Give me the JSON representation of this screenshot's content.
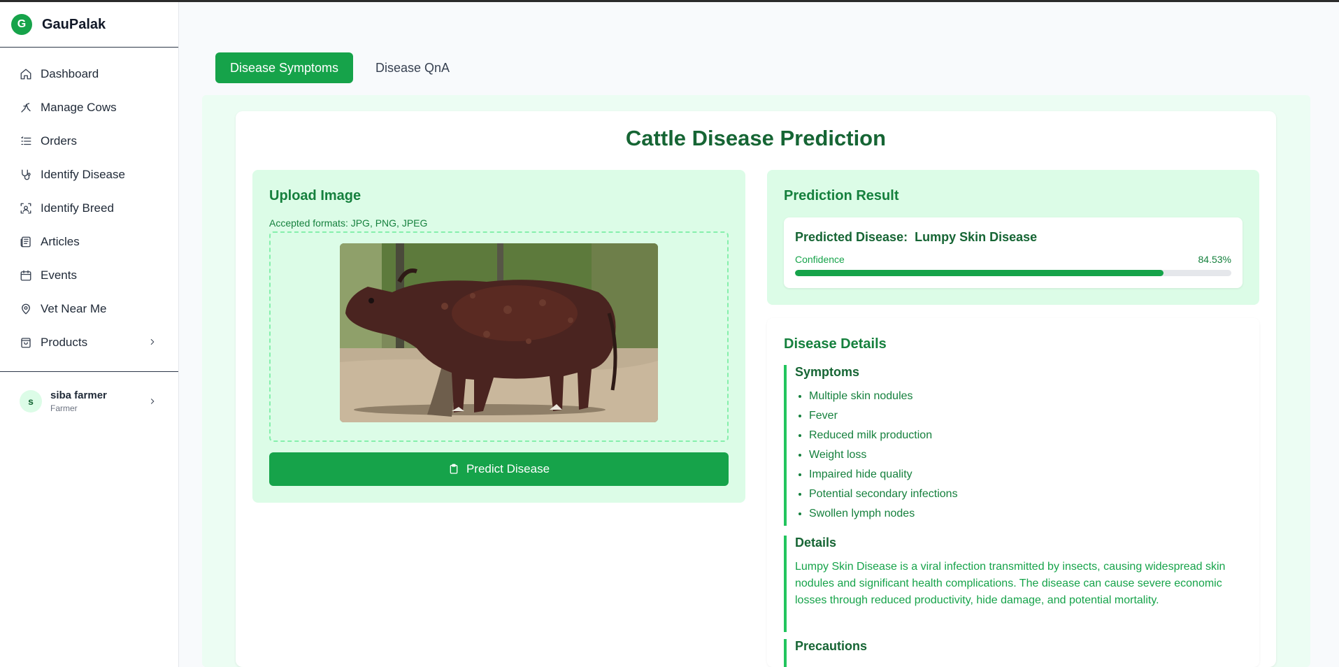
{
  "app": {
    "logo_letter": "G",
    "name": "GauPalak"
  },
  "sidebar": {
    "items": [
      {
        "label": "Dashboard",
        "icon": "home-icon"
      },
      {
        "label": "Manage Cows",
        "icon": "cow-icon"
      },
      {
        "label": "Orders",
        "icon": "list-icon"
      },
      {
        "label": "Identify Disease",
        "icon": "stethoscope-icon"
      },
      {
        "label": "Identify Breed",
        "icon": "scan-icon"
      },
      {
        "label": "Articles",
        "icon": "newspaper-icon"
      },
      {
        "label": "Events",
        "icon": "calendar-icon"
      },
      {
        "label": "Vet Near Me",
        "icon": "map-pin-icon"
      },
      {
        "label": "Products",
        "icon": "shopping-bag-icon",
        "has_submenu": true
      }
    ],
    "user": {
      "initial": "s",
      "name": "siba farmer",
      "role": "Farmer"
    }
  },
  "tabs": [
    {
      "label": "Disease Symptoms",
      "active": true
    },
    {
      "label": "Disease QnA",
      "active": false
    }
  ],
  "page": {
    "title": "Cattle Disease Prediction"
  },
  "upload": {
    "heading": "Upload Image",
    "formats": "Accepted formats: JPG, PNG, JPEG",
    "button_label": "Predict Disease"
  },
  "result": {
    "heading": "Prediction Result",
    "predicted_label": "Predicted Disease:",
    "predicted_value": "Lumpy Skin Disease",
    "confidence_label": "Confidence",
    "confidence_text": "84.53%",
    "confidence_fraction": 0.8453
  },
  "details": {
    "heading": "Disease Details",
    "symptoms_heading": "Symptoms",
    "symptoms": [
      "Multiple skin nodules",
      "Fever",
      "Reduced milk production",
      "Weight loss",
      "Impaired hide quality",
      "Potential secondary infections",
      "Swollen lymph nodes"
    ],
    "details_heading": "Details",
    "details_text": "Lumpy Skin Disease is a viral infection transmitted by insects, causing widespread skin nodules and significant health complications. The disease can cause severe economic losses through reduced productivity, hide damage, and potential mortality.",
    "precautions_heading": "Precautions"
  },
  "colors": {
    "accent": "#16a34a",
    "accent_dark": "#166534",
    "panel_bg": "#dcfce7",
    "wrap_bg": "#ecfdf3"
  }
}
